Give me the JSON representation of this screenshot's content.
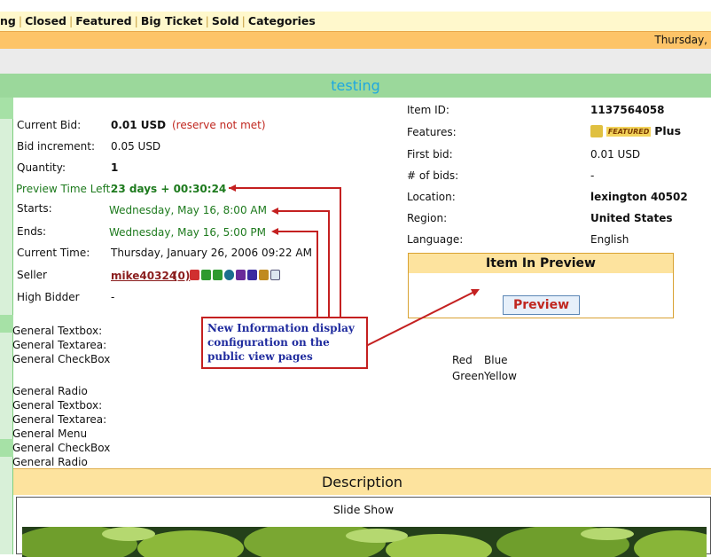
{
  "nav": {
    "items": [
      "ng",
      "Closed",
      "Featured",
      "Big Ticket",
      "Sold",
      "Categories"
    ]
  },
  "date_bar": "Thursday,",
  "title": "testing",
  "left_fields": {
    "current_bid_label": "Current Bid:",
    "current_bid_value": "0.01 USD",
    "reserve_note": "(reserve not met)",
    "bid_increment_label": "Bid increment:",
    "bid_increment_value": "0.05 USD",
    "quantity_label": "Quantity:",
    "quantity_value": "1",
    "preview_time_label": "Preview Time Left:",
    "preview_time_value": "23 days + 00:30:24",
    "starts_label": "Starts:",
    "starts_value": "Wednesday, May 16,  8:00 AM",
    "ends_label": "Ends:",
    "ends_value": "Wednesday, May 16,  5:00 PM",
    "current_time_label": "Current Time:",
    "current_time_value": "Thursday, January 26, 2006 09:22 AM",
    "seller_label": "Seller",
    "seller_value": "mike40324",
    "seller_feedback": "(0)",
    "high_bidder_label": "High Bidder",
    "high_bidder_value": "-"
  },
  "right_fields": {
    "item_id_label": "Item ID:",
    "item_id_value": "1137564058",
    "features_label": "Features:",
    "features_badge": "FEATURED",
    "features_value": "Plus",
    "first_bid_label": "First bid:",
    "first_bid_value": "0.01 USD",
    "bids_label": "# of bids:",
    "bids_value": "-",
    "location_label": "Location:",
    "location_value": "lexington 40502",
    "region_label": "Region:",
    "region_value": "United States",
    "language_label": "Language:",
    "language_value": "English"
  },
  "preview_box": {
    "title": "Item In Preview",
    "button": "Preview"
  },
  "callout": "New Information display configuration on the public view pages",
  "general_fields": [
    "General Textbox:",
    "General Textarea:",
    "General CheckBox",
    "General Radio",
    "General Textbox:",
    "General Textarea:",
    "General Menu",
    "General CheckBox",
    "General Radio"
  ],
  "colors_list": [
    "Red",
    "Blue",
    "Green",
    "Yellow"
  ],
  "description_title": "Description",
  "slideshow_title": "Slide Show",
  "colors": {
    "nav_bg": "#fff8cc",
    "date_bar_bg": "#fdc468",
    "title_bar_bg": "#9bd89b",
    "title_text": "#1ea8e0",
    "callout_border": "#c42020",
    "callout_text": "#1f2b9e"
  }
}
